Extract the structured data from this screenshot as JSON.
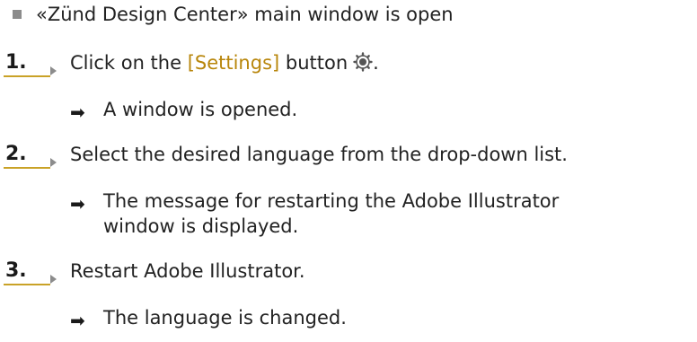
{
  "prerequisite": "«Zünd Design Center» main window is open",
  "steps": [
    {
      "number": "1.",
      "text_before": "Click on the ",
      "keyword": "[Settings]",
      "text_after": " button",
      "suffix": ".",
      "icon": "settings-gear-icon",
      "result": "A window is opened."
    },
    {
      "number": "2.",
      "text": "Select the desired language from the drop-down list.",
      "result_line1": "The message for restarting the Adobe Illustrator",
      "result_line2": "window is displayed."
    },
    {
      "number": "3.",
      "text": "Restart Adobe Illustrator.",
      "result": "The language is changed."
    }
  ],
  "result_arrow_glyph": "➡",
  "colors": {
    "text": "#222222",
    "keyword": "#b8860b",
    "step_underline": "#c9a227",
    "bullet": "#8c8c8c"
  }
}
